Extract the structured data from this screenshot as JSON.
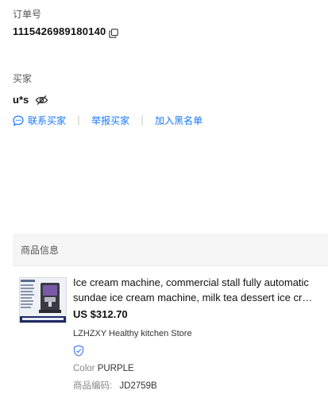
{
  "order": {
    "label": "订单号",
    "number": "1115426989180140",
    "copy_icon": "copy-icon"
  },
  "buyer": {
    "label": "买家",
    "name": "u*s",
    "hidden_icon": "eye-slash-icon",
    "actions": {
      "contact_icon": "chat-icon",
      "contact": "联系买家",
      "report": "举报买家",
      "blacklist": "加入黑名单"
    }
  },
  "product_section": {
    "header": "商品信息",
    "item": {
      "thumbnail_icon": "ice-cream-machine-image",
      "title": "Ice cream machine, commercial stall fully automatic sundae ice cream machine, milk tea dessert ice cream machine",
      "price": "US $312.70",
      "store": "LZHZXY Healthy kitchen Store",
      "verified_icon": "shield-check-icon",
      "color_label": "Color",
      "color_value": "PURPLE",
      "sku_label": "商品编码:",
      "sku_value": "JD2759B"
    }
  },
  "colors": {
    "link": "#1677ff",
    "verified": "#4a7df3"
  }
}
